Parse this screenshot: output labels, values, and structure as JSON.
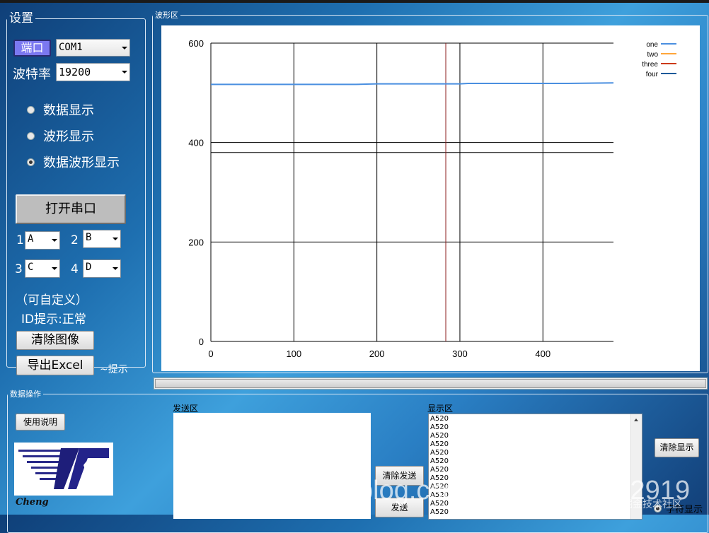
{
  "settings": {
    "legend": "设置",
    "port_button": "端口",
    "port_value": "COM1",
    "baud_label": "波特率",
    "baud_value": "19200",
    "modes": [
      {
        "label": "数据显示",
        "selected": false
      },
      {
        "label": "波形显示",
        "selected": false
      },
      {
        "label": "数据波形显示",
        "selected": true
      }
    ],
    "open_port_button": "打开串口",
    "channels": [
      {
        "num": "1",
        "value": "A"
      },
      {
        "num": "2",
        "value": "B"
      },
      {
        "num": "3",
        "value": "C"
      },
      {
        "num": "4",
        "value": "D"
      }
    ],
    "custom_note": "（可自定义）",
    "id_hint": "ID提示:正常",
    "clear_image_button": "清除图像",
    "export_excel_button": "导出Excel",
    "tip_label": "~提示"
  },
  "waveform": {
    "legend": "波形区"
  },
  "chart_data": {
    "type": "line",
    "title": "",
    "xlabel": "",
    "ylabel": "",
    "xlim": [
      0,
      485
    ],
    "ylim": [
      0,
      600
    ],
    "x_ticks": [
      0,
      100,
      200,
      300,
      400
    ],
    "y_ticks": [
      0,
      200,
      400,
      600
    ],
    "grid": true,
    "extra_hline": 380,
    "cursor_x": 283,
    "legend_position": "top-right",
    "series": [
      {
        "name": "one",
        "color": "#4a8fe0",
        "x": [
          0,
          100,
          175,
          200,
          300,
          310,
          430,
          485
        ],
        "y": [
          517,
          517,
          517,
          518,
          518,
          519,
          519,
          520
        ]
      },
      {
        "name": "two",
        "color": "#ffa63a",
        "x": [],
        "y": []
      },
      {
        "name": "three",
        "color": "#cc3a10",
        "x": [],
        "y": []
      },
      {
        "name": "four",
        "color": "#1a5a9a",
        "x": [],
        "y": []
      }
    ]
  },
  "data_ops": {
    "legend": "数据操作",
    "help_button": "使用说明",
    "logo_caption": "Cheng",
    "send_area_label": "发送区",
    "send_text": "",
    "clear_send_button": "清除发送",
    "send_button": "发送",
    "display_area_label": "显示区",
    "display_lines": [
      "A520",
      "A520",
      "A520",
      "A520",
      "A520",
      "A520",
      "A520",
      "A520",
      "A520",
      "A520",
      "A520",
      "A520"
    ],
    "clear_display_button": "清除显示",
    "char_display_option": "字符显示"
  },
  "watermark": "blog.csdn.net/qq_20222919",
  "footer_badge": "@稀土掘金技术社区",
  "colors": {
    "port_button_bg": "#7b78f0",
    "series_one": "#4a8fe0",
    "series_two": "#ffa63a",
    "series_three": "#cc3a10",
    "series_four": "#1a5a9a"
  }
}
